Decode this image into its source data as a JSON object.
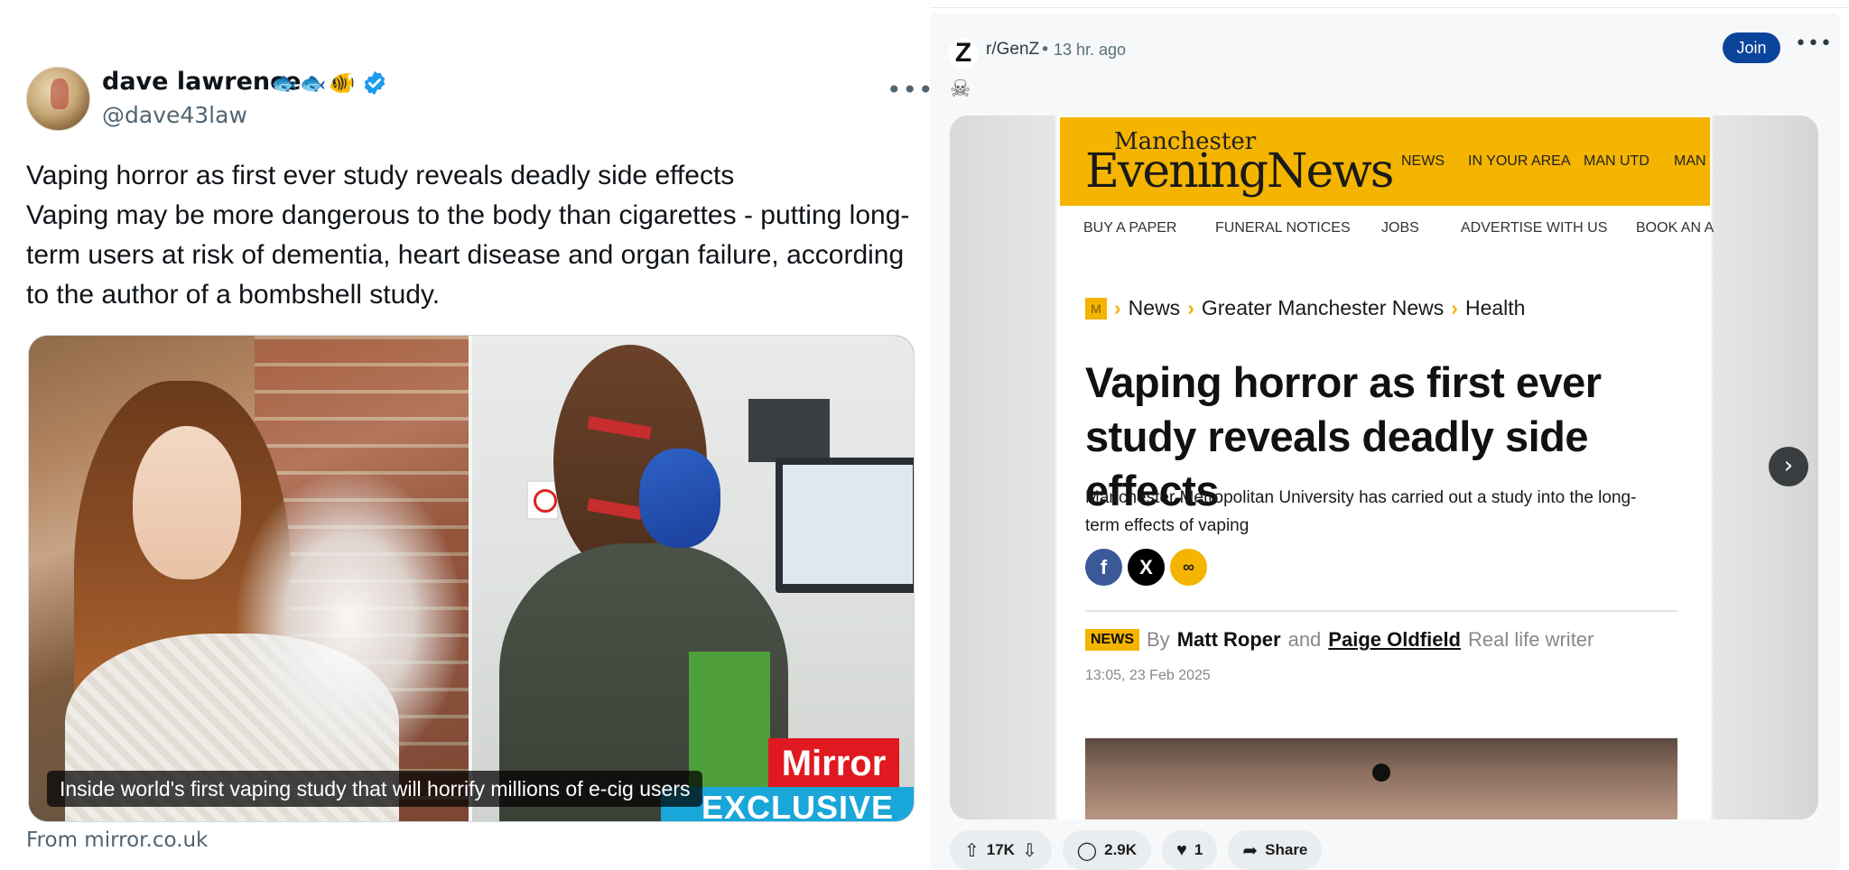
{
  "tweet": {
    "display_name": "dave lawrence",
    "handle": "@dave43law",
    "name_emojis": [
      "🐟",
      "🐟",
      "🐠"
    ],
    "text_lines": [
      "Vaping horror as first ever study reveals deadly side effects",
      "Vaping may be more dangerous to the body than cigarettes - putting long-term users at risk of dementia, heart disease and organ failure, according to the author of a bombshell study."
    ],
    "media": {
      "caption": "Inside world's first vaping study that will horrify millions of e-cig users",
      "brand": "Mirror",
      "badge": "EXCLUSIVE"
    },
    "source": "From mirror.co.uk"
  },
  "reddit": {
    "subreddit": "r/GenZ",
    "subreddit_icon": "Z",
    "separator": "•",
    "time": "13 hr. ago",
    "join_label": "Join",
    "more_label": "•••",
    "flair_icon": "☠",
    "article": {
      "logo_top": "Manchester",
      "logo_main": "EveningNews",
      "nav": [
        "NEWS",
        "IN YOUR AREA",
        "MAN UTD",
        "MAN"
      ],
      "subnav": [
        "BUY A PAPER",
        "FUNERAL NOTICES",
        "JOBS",
        "ADVERTISE WITH US",
        "BOOK AN A"
      ],
      "breadcrumbs": [
        "News",
        "Greater Manchester News",
        "Health"
      ],
      "headline": "Vaping horror as first ever study reveals deadly side effects",
      "standfirst": "Manchester Metropolitan University has carried out a study into the long-term effects of vaping",
      "tag": "NEWS",
      "by": "By",
      "author1": "Matt Roper",
      "and": "and",
      "author2": "Paige Oldfield",
      "role": "Real life writer",
      "date": "13:05, 23 Feb 2025"
    },
    "actions": {
      "upvotes": "17K",
      "comments": "2.9K",
      "awards": "1",
      "share": "Share"
    }
  }
}
